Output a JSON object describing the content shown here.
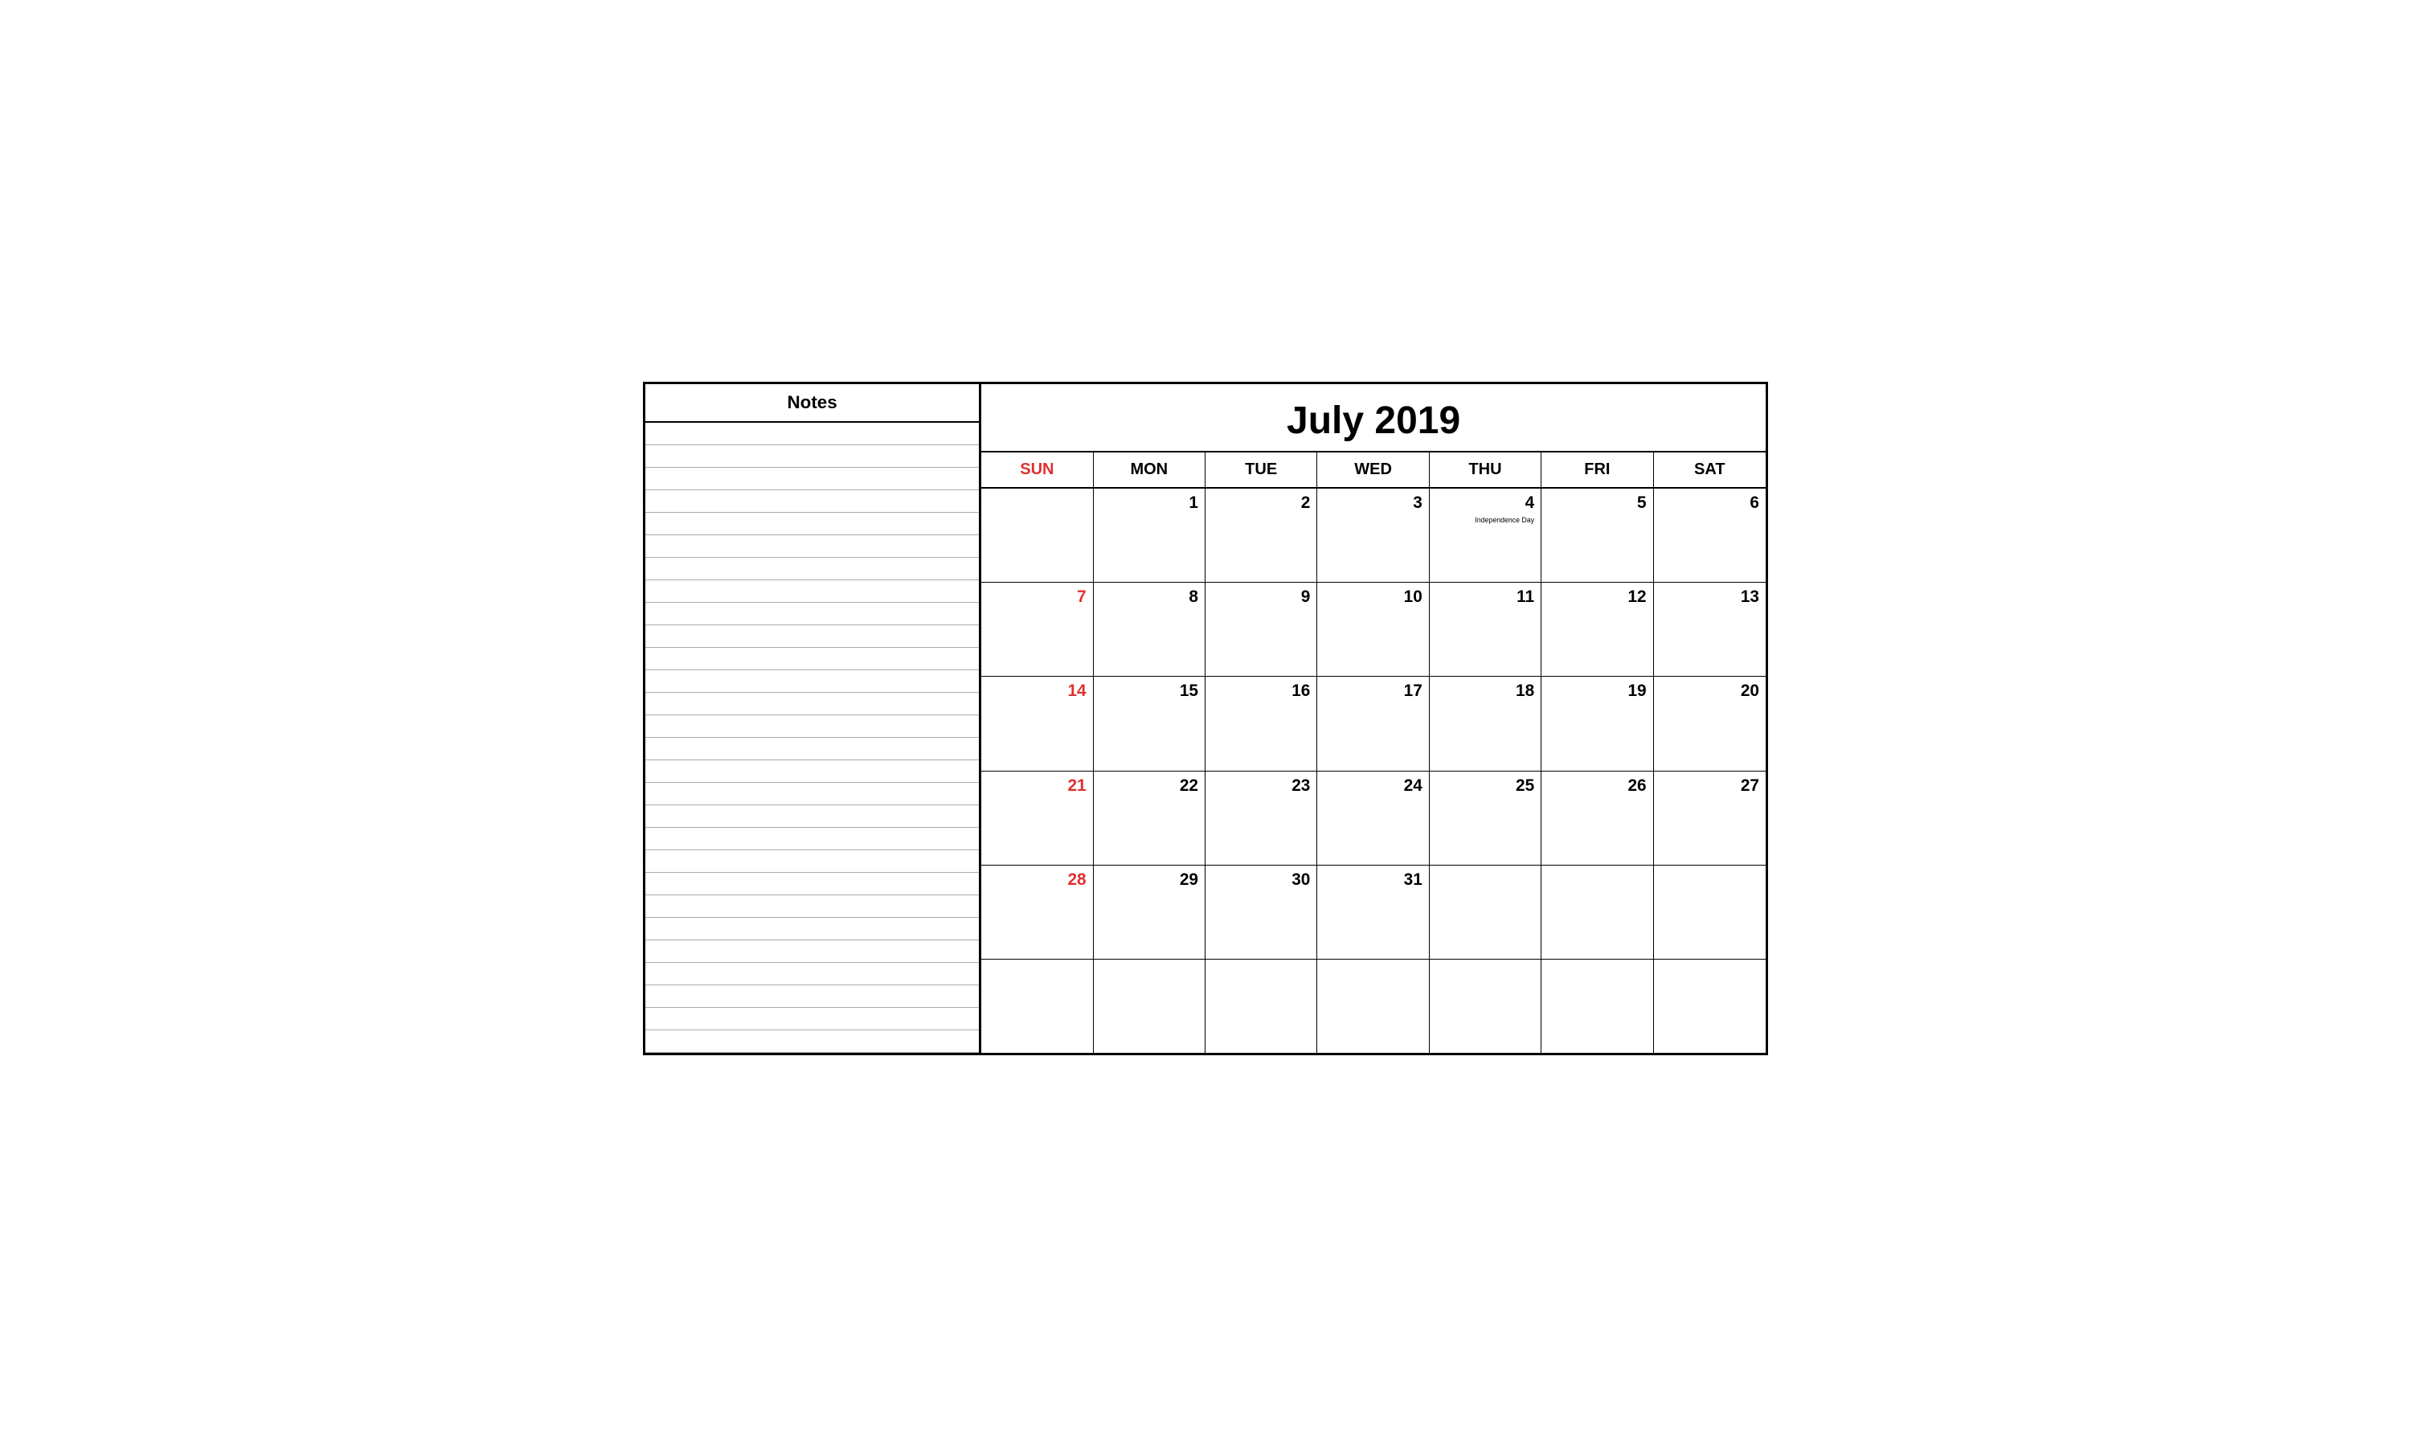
{
  "notes": {
    "header": "Notes",
    "line_count": 28
  },
  "calendar": {
    "title": "July 2019",
    "days_of_week": [
      {
        "label": "SUN",
        "is_sunday": true
      },
      {
        "label": "MON",
        "is_sunday": false
      },
      {
        "label": "TUE",
        "is_sunday": false
      },
      {
        "label": "WED",
        "is_sunday": false
      },
      {
        "label": "THU",
        "is_sunday": false
      },
      {
        "label": "FRI",
        "is_sunday": false
      },
      {
        "label": "SAT",
        "is_sunday": false
      }
    ],
    "weeks": [
      [
        {
          "day": "",
          "sunday": false,
          "empty": true,
          "holiday": ""
        },
        {
          "day": "1",
          "sunday": false,
          "empty": false,
          "holiday": ""
        },
        {
          "day": "2",
          "sunday": false,
          "empty": false,
          "holiday": ""
        },
        {
          "day": "3",
          "sunday": false,
          "empty": false,
          "holiday": ""
        },
        {
          "day": "4",
          "sunday": false,
          "empty": false,
          "holiday": "Independence Day"
        },
        {
          "day": "5",
          "sunday": false,
          "empty": false,
          "holiday": ""
        },
        {
          "day": "6",
          "sunday": false,
          "empty": false,
          "holiday": ""
        }
      ],
      [
        {
          "day": "7",
          "sunday": true,
          "empty": false,
          "holiday": ""
        },
        {
          "day": "8",
          "sunday": false,
          "empty": false,
          "holiday": ""
        },
        {
          "day": "9",
          "sunday": false,
          "empty": false,
          "holiday": ""
        },
        {
          "day": "10",
          "sunday": false,
          "empty": false,
          "holiday": ""
        },
        {
          "day": "11",
          "sunday": false,
          "empty": false,
          "holiday": ""
        },
        {
          "day": "12",
          "sunday": false,
          "empty": false,
          "holiday": ""
        },
        {
          "day": "13",
          "sunday": false,
          "empty": false,
          "holiday": ""
        }
      ],
      [
        {
          "day": "14",
          "sunday": true,
          "empty": false,
          "holiday": ""
        },
        {
          "day": "15",
          "sunday": false,
          "empty": false,
          "holiday": ""
        },
        {
          "day": "16",
          "sunday": false,
          "empty": false,
          "holiday": ""
        },
        {
          "day": "17",
          "sunday": false,
          "empty": false,
          "holiday": ""
        },
        {
          "day": "18",
          "sunday": false,
          "empty": false,
          "holiday": ""
        },
        {
          "day": "19",
          "sunday": false,
          "empty": false,
          "holiday": ""
        },
        {
          "day": "20",
          "sunday": false,
          "empty": false,
          "holiday": ""
        }
      ],
      [
        {
          "day": "21",
          "sunday": true,
          "empty": false,
          "holiday": ""
        },
        {
          "day": "22",
          "sunday": false,
          "empty": false,
          "holiday": ""
        },
        {
          "day": "23",
          "sunday": false,
          "empty": false,
          "holiday": ""
        },
        {
          "day": "24",
          "sunday": false,
          "empty": false,
          "holiday": ""
        },
        {
          "day": "25",
          "sunday": false,
          "empty": false,
          "holiday": ""
        },
        {
          "day": "26",
          "sunday": false,
          "empty": false,
          "holiday": ""
        },
        {
          "day": "27",
          "sunday": false,
          "empty": false,
          "holiday": ""
        }
      ],
      [
        {
          "day": "28",
          "sunday": true,
          "empty": false,
          "holiday": ""
        },
        {
          "day": "29",
          "sunday": false,
          "empty": false,
          "holiday": ""
        },
        {
          "day": "30",
          "sunday": false,
          "empty": false,
          "holiday": ""
        },
        {
          "day": "31",
          "sunday": false,
          "empty": false,
          "holiday": ""
        },
        {
          "day": "",
          "sunday": false,
          "empty": true,
          "holiday": ""
        },
        {
          "day": "",
          "sunday": false,
          "empty": true,
          "holiday": ""
        },
        {
          "day": "",
          "sunday": false,
          "empty": true,
          "holiday": ""
        }
      ],
      [
        {
          "day": "",
          "sunday": false,
          "empty": true,
          "holiday": ""
        },
        {
          "day": "",
          "sunday": false,
          "empty": true,
          "holiday": ""
        },
        {
          "day": "",
          "sunday": false,
          "empty": true,
          "holiday": ""
        },
        {
          "day": "",
          "sunday": false,
          "empty": true,
          "holiday": ""
        },
        {
          "day": "",
          "sunday": false,
          "empty": true,
          "holiday": ""
        },
        {
          "day": "",
          "sunday": false,
          "empty": true,
          "holiday": ""
        },
        {
          "day": "",
          "sunday": false,
          "empty": true,
          "holiday": ""
        }
      ]
    ]
  }
}
